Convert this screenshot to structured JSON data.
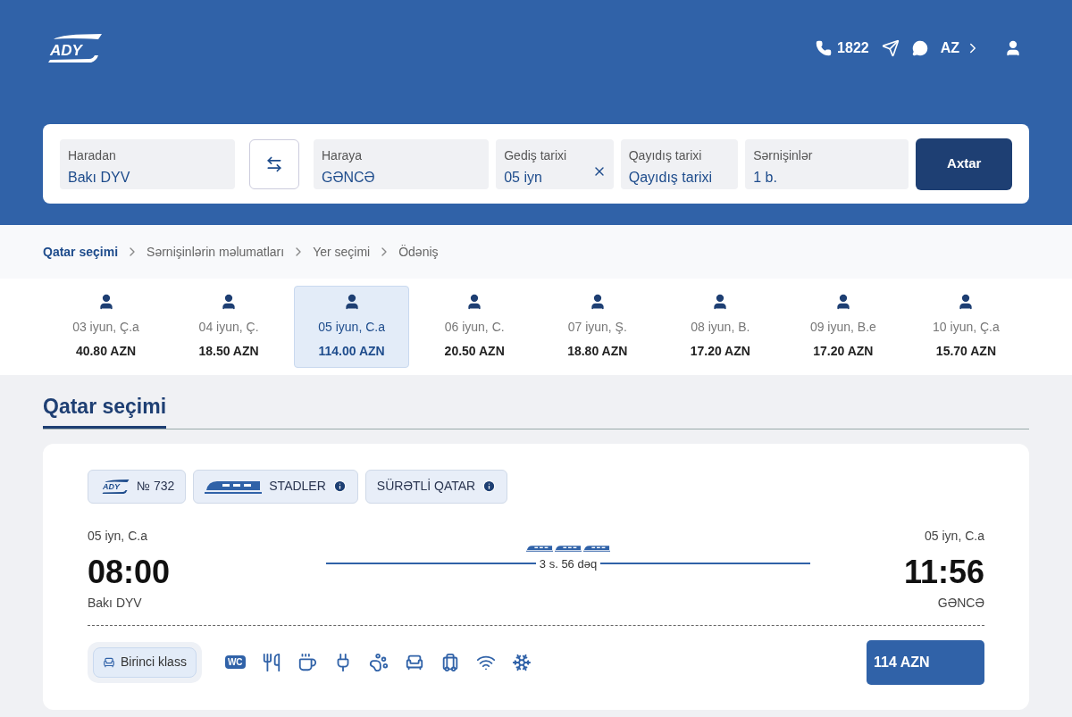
{
  "header": {
    "logo": "ADY",
    "phone": "1822",
    "language": "AZ"
  },
  "search": {
    "fields": [
      {
        "label": "Haradan",
        "value": "Bakı DYV"
      },
      {
        "label": "Haraya",
        "value": "GƏNCƏ"
      },
      {
        "label": "Gediş tarixi",
        "value": "05 iyn",
        "clearable": true
      },
      {
        "label": "Qayıdış tarixi",
        "placeholder": "Qayıdış tarixi"
      },
      {
        "label": "Sərnişinlər",
        "value": "1 b."
      }
    ],
    "button": "Axtar"
  },
  "breadcrumbs": [
    {
      "label": "Qatar seçimi",
      "selected": true
    },
    {
      "label": "Sərnişinlərin məlumatları",
      "selected": false
    },
    {
      "label": "Yer seçimi",
      "selected": false
    },
    {
      "label": "Ödəniş",
      "selected": false
    }
  ],
  "dates": [
    {
      "date": "03 iyun, Ç.a",
      "price": "40.80 AZN",
      "selected": false
    },
    {
      "date": "04 iyun, Ç.",
      "price": "18.50 AZN",
      "selected": false
    },
    {
      "date": "05 iyun, C.a",
      "price": "114.00 AZN",
      "selected": true
    },
    {
      "date": "06 iyun, C.",
      "price": "20.50 AZN",
      "selected": false
    },
    {
      "date": "07 iyun, Ş.",
      "price": "18.80 AZN",
      "selected": false
    },
    {
      "date": "08 iyun, B.",
      "price": "17.20 AZN",
      "selected": false
    },
    {
      "date": "09 iyun, B.e",
      "price": "17.20 AZN",
      "selected": false
    },
    {
      "date": "10 iyun, Ç.a",
      "price": "15.70 AZN",
      "selected": false
    }
  ],
  "section_title": "Qatar seçimi",
  "train": {
    "badges": [
      {
        "kind": "number",
        "logo": "ADY",
        "text": "№ 732"
      },
      {
        "kind": "model",
        "text": "STADLER"
      },
      {
        "kind": "type",
        "text": "SÜRƏTLİ QATAR"
      }
    ],
    "departure": {
      "date": "05 iyn, C.a",
      "time": "08:00",
      "station": "Bakı DYV"
    },
    "duration": "3 s. 56 dəq",
    "arrival": {
      "date": "05 iyn, C.a",
      "time": "11:56",
      "station": "GƏNCƏ"
    },
    "class": "Birinci klass",
    "amenities": [
      {
        "kind": "wc",
        "text": "WC"
      },
      {
        "kind": "food"
      },
      {
        "kind": "coffee"
      },
      {
        "kind": "socket"
      },
      {
        "kind": "pets"
      },
      {
        "kind": "seat"
      },
      {
        "kind": "luggage"
      },
      {
        "kind": "wifi"
      },
      {
        "kind": "ac"
      }
    ],
    "price": "114 AZN"
  }
}
